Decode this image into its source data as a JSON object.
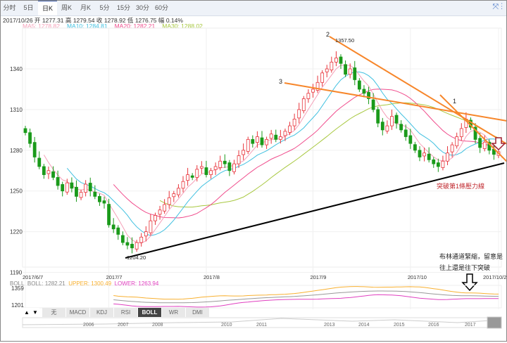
{
  "tabs": [
    "分时",
    "5日",
    "日K",
    "周K",
    "月K",
    "5分",
    "15分",
    "30分",
    "60分"
  ],
  "active_tab": 2,
  "info": {
    "date": "2017/10/26",
    "open_label": "开",
    "open": "1277.31",
    "high_label": "高",
    "high": "1279.54",
    "close_label": "收",
    "close": "1278.92",
    "low_label": "低",
    "low": "1276.75",
    "change_label": "幅",
    "change": "0.14%"
  },
  "ma": [
    {
      "label": "MA5: 1278.82",
      "color": "#f5a0b8"
    },
    {
      "label": "MA10: 1284.81",
      "color": "#40c0e0"
    },
    {
      "label": "MA20: 1282.21",
      "color": "#f04c8c"
    },
    {
      "label": "MA30: 1288.02",
      "color": "#a8c840"
    }
  ],
  "boll_legend": {
    "name": "BOLL",
    "boll": "BOLL: 1282.21",
    "upper": "UPPER: 1300.49",
    "lower": "LOWER: 1263.94",
    "upper_color": "#f8b030",
    "lower_color": "#e040c0"
  },
  "boll_axis": [
    "1359",
    "1201"
  ],
  "indicator_tabs": [
    "无",
    "MACD",
    "KDJ",
    "RSI",
    "BOLL",
    "WR",
    "DMI"
  ],
  "indicator_active": 4,
  "navigator_years": [
    "2006",
    "2007",
    "2008",
    "2010",
    "2011",
    "2013",
    "2014",
    "2015",
    "2016",
    "2017"
  ],
  "annotations": {
    "peak_num": "2",
    "peak_val": "1357.50",
    "line3": "3",
    "line1": "1",
    "low_val": "1204.20",
    "breakout": "突破第1條壓力線",
    "note1": "布林通道緊縮，留意是",
    "note2": "往上還是往下突破"
  },
  "colors": {
    "up": "#e8333a",
    "down": "#1a9a1a",
    "trend": "#f7862a",
    "support": "#000000"
  },
  "chart_data": {
    "type": "candlestick",
    "y_ticks": [
      1340,
      1310,
      1280,
      1250,
      1220,
      1190
    ],
    "ylim": [
      1190,
      1360
    ],
    "x_ticks": [
      "2017/6/7",
      "2017/7",
      "2017/8",
      "2017/9",
      "2017/10",
      "2017/10/26"
    ],
    "x_tick_index": [
      0,
      18,
      39,
      62,
      83,
      102
    ],
    "closes": [
      1293,
      1285,
      1275,
      1268,
      1262,
      1265,
      1260,
      1254,
      1250,
      1256,
      1252,
      1246,
      1249,
      1255,
      1250,
      1246,
      1242,
      1241,
      1225,
      1222,
      1218,
      1212,
      1210,
      1208,
      1212,
      1216,
      1220,
      1228,
      1232,
      1236,
      1240,
      1245,
      1248,
      1252,
      1257,
      1262,
      1260,
      1266,
      1268,
      1262,
      1265,
      1268,
      1272,
      1270,
      1265,
      1270,
      1276,
      1280,
      1288,
      1285,
      1290,
      1284,
      1288,
      1292,
      1288,
      1290,
      1294,
      1298,
      1303,
      1310,
      1318,
      1322,
      1325,
      1330,
      1337,
      1340,
      1345,
      1348,
      1344,
      1336,
      1340,
      1332,
      1325,
      1322,
      1318,
      1310,
      1300,
      1295,
      1298,
      1305,
      1300,
      1295,
      1290,
      1285,
      1280,
      1275,
      1278,
      1273,
      1270,
      1268,
      1272,
      1278,
      1284,
      1290,
      1296,
      1303,
      1297,
      1288,
      1282,
      1286,
      1280,
      1277,
      1278.92
    ]
  }
}
